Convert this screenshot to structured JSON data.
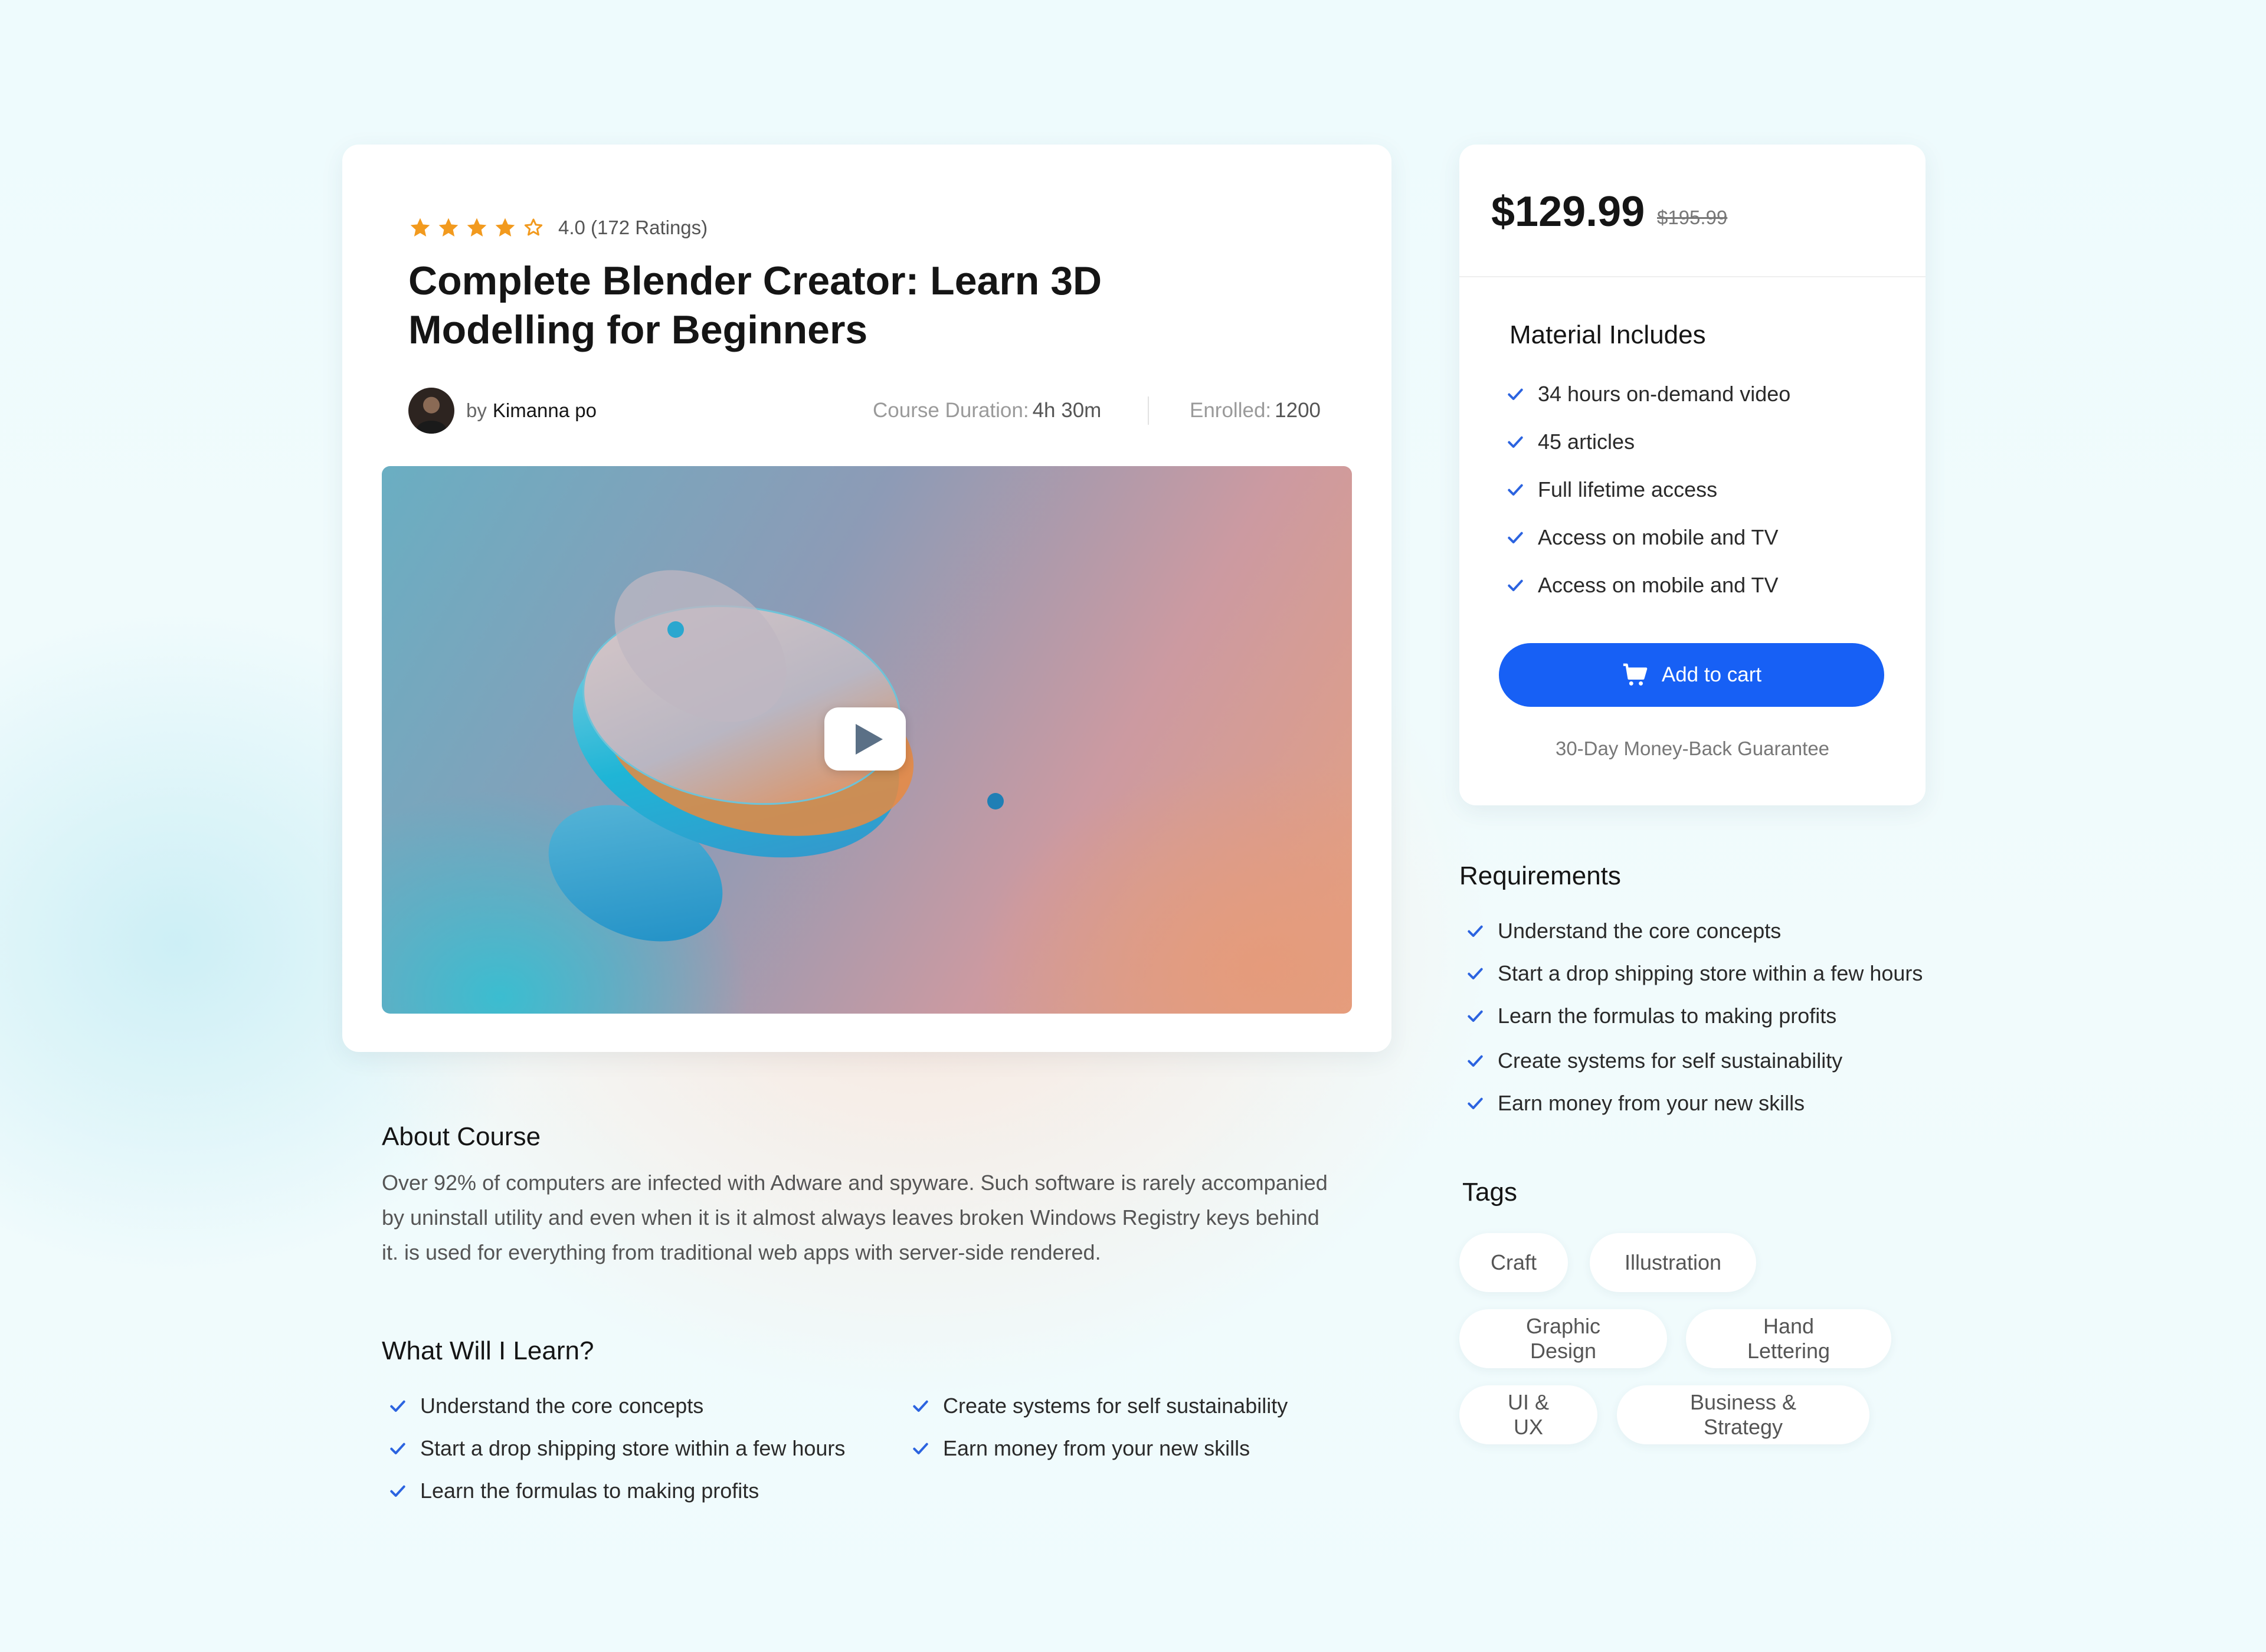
{
  "colors": {
    "accent": "#1760f5",
    "star": "#f29a1e",
    "check": "#2b63e0",
    "heading": "#151515",
    "body_text": "#555555"
  },
  "course": {
    "rating": 4.0,
    "rating_text": "4.0 (172 Ratings)",
    "stars_filled": 4,
    "stars_total": 5,
    "title": "Complete Blender Creator: Learn 3D Modelling for Beginners",
    "author_prefix": "by",
    "author_name": "Kimanna po",
    "duration_label": "Course Duration:",
    "duration_value": "4h 30m",
    "enrolled_label": "Enrolled:",
    "enrolled_value": "1200",
    "video_play_icon": "play-icon"
  },
  "about": {
    "title": "About Course",
    "text": "Over 92% of computers are infected with Adware and spyware. Such software is rarely accompanied by uninstall utility and even when it is it almost always leaves broken Windows Registry keys behind it. is used for everything from traditional web apps with server-side rendered."
  },
  "learn": {
    "title": "What Will I Learn?",
    "left": [
      "Understand the core concepts",
      "Start a drop shipping store within a few hours",
      "Learn the formulas to making profits"
    ],
    "right": [
      "Create systems for self sustainability",
      "Earn money from your new skills"
    ]
  },
  "pricing": {
    "price": "$129.99",
    "old_price": "$195.99",
    "includes_title": "Material Includes",
    "includes": [
      "34 hours on-demand video",
      "45 articles",
      "Full lifetime access",
      "Access on mobile and TV",
      "Access on mobile and TV"
    ],
    "cart_label": "Add to cart",
    "cart_icon": "cart-icon",
    "guarantee": "30-Day Money-Back Guarantee"
  },
  "requirements": {
    "title": "Requirements",
    "items": [
      "Understand the core concepts",
      "Start a drop shipping store within a few hours",
      "Learn the formulas to making profits",
      "Create systems for self sustainability",
      "Earn money from your new skills"
    ]
  },
  "tags": {
    "title": "Tags",
    "items": [
      "Craft",
      "Illustration",
      "Graphic Design",
      "Hand Lettering",
      "UI & UX",
      "Business & Strategy"
    ]
  }
}
